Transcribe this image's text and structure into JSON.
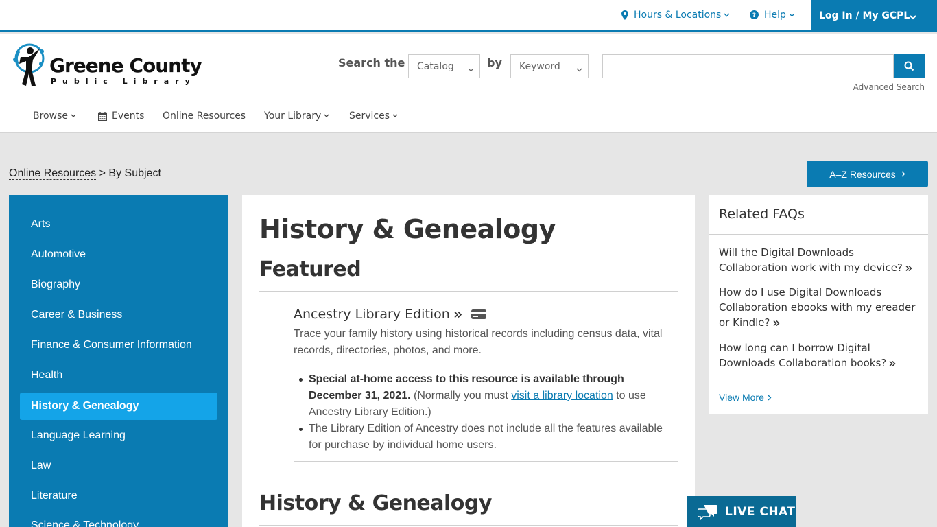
{
  "utility": {
    "hours_label": "Hours & Locations",
    "help_label": "Help",
    "login_label": "Log In / My GCPL"
  },
  "logo": {
    "name": "Greene County",
    "subtitle": "Public Library"
  },
  "search": {
    "label": "Search the",
    "scope_selected": "Catalog",
    "by_label": "by",
    "field_selected": "Keyword",
    "query_value": "",
    "advanced_label": "Advanced Search"
  },
  "nav": {
    "browse": "Browse",
    "events": "Events",
    "online_resources": "Online Resources",
    "your_library": "Your Library",
    "services": "Services"
  },
  "breadcrumb": {
    "parent": "Online Resources",
    "separator": " > ",
    "current": "By Subject"
  },
  "az_button": "A–Z Resources",
  "sidebar": {
    "items": [
      {
        "label": "Arts"
      },
      {
        "label": "Automotive"
      },
      {
        "label": "Biography"
      },
      {
        "label": "Career & Business"
      },
      {
        "label": "Finance & Consumer Information"
      },
      {
        "label": "Health"
      },
      {
        "label": "History & Genealogy",
        "active": true
      },
      {
        "label": "Language Learning"
      },
      {
        "label": "Law"
      },
      {
        "label": "Literature"
      },
      {
        "label": "Science & Technology"
      }
    ]
  },
  "main": {
    "title": "History & Genealogy",
    "featured_heading": "Featured",
    "resource": {
      "title": "Ancestry Library Edition",
      "description": "Trace your family history using historical records including census data, vital records, directories, photos, and more.",
      "bullet1_strong": "Special at-home access to this resource is available through December 31, 2021.",
      "bullet1_pre": " (Normally you must ",
      "bullet1_link": "visit a library location",
      "bullet1_post": " to use Ancestry Library Edition.)",
      "bullet2": "The Library Edition of Ancestry does not include all the features available for purchase by individual home users."
    },
    "section_heading": "History & Genealogy"
  },
  "faq": {
    "title": "Related FAQs",
    "items": [
      {
        "text": "Will the Digital Downloads Collaboration work with my device?"
      },
      {
        "text": "How do I use Digital Downloads Collaboration ebooks with my ereader or Kindle?"
      },
      {
        "text": "How long can I borrow Digital Downloads Collaboration books?"
      }
    ],
    "more_label": "View More"
  },
  "chat": {
    "label": "LIVE CHAT"
  },
  "colors": {
    "brand_blue": "#0a7bb2",
    "active_blue": "#14a4e8",
    "page_bg": "#e6e6e6"
  }
}
